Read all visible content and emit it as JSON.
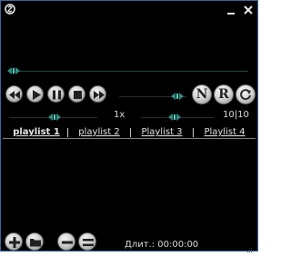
{
  "window": {
    "title": ""
  },
  "player": {
    "speed_label": "1x",
    "counter_label": "10|10",
    "logo_n": "N",
    "logo_r": "R"
  },
  "playlists": {
    "tabs": [
      {
        "label": "playlist 1",
        "active": true
      },
      {
        "label": "playlist 2",
        "active": false
      },
      {
        "label": "Playlist 3",
        "active": false
      },
      {
        "label": "Playlist 4",
        "active": false
      }
    ]
  },
  "status": {
    "duration_label": "Длит.: 00:00:00"
  },
  "icons": {
    "app": "app-icon",
    "minimize": "minimize-icon",
    "close": "close-icon",
    "rewind": "rewind-icon",
    "play": "play-icon",
    "pause": "pause-icon",
    "stop": "stop-icon",
    "forward": "fast-forward-icon",
    "repeat": "repeat-icon",
    "add": "plus-icon",
    "folder": "folder-icon",
    "remove": "minus-icon",
    "remove_all": "minus-minus-icon"
  },
  "colors": {
    "background": "#000000",
    "accent": "#2f8f86",
    "frame": "#3a6ea5"
  }
}
